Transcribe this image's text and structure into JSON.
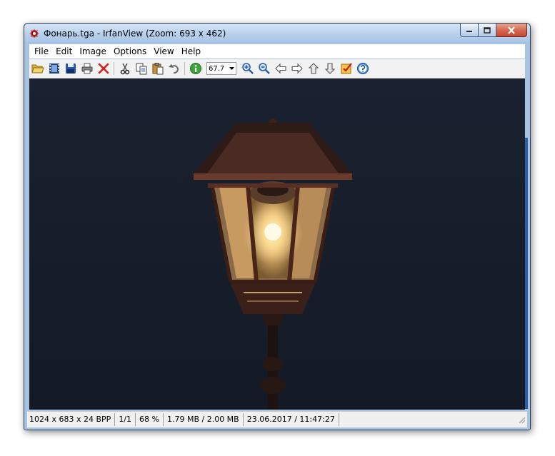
{
  "window": {
    "title": "Фонарь.tga - IrfanView (Zoom: 693 x 462)"
  },
  "menu": {
    "items": [
      "File",
      "Edit",
      "Image",
      "Options",
      "View",
      "Help"
    ]
  },
  "toolbar": {
    "buttons": [
      {
        "icon": "open-folder-icon"
      },
      {
        "icon": "filmstrip-icon"
      },
      {
        "icon": "save-icon"
      },
      {
        "icon": "print-icon"
      },
      {
        "icon": "delete-icon"
      },
      {
        "icon": "cut-icon"
      },
      {
        "icon": "copy-icon"
      },
      {
        "icon": "paste-icon"
      },
      {
        "icon": "undo-icon"
      },
      {
        "icon": "info-icon"
      },
      {
        "icon": "zoom-in-icon"
      },
      {
        "icon": "zoom-out-icon"
      },
      {
        "icon": "previous-arrow-icon"
      },
      {
        "icon": "next-arrow-icon"
      },
      {
        "icon": "first-file-icon"
      },
      {
        "icon": "last-file-icon"
      },
      {
        "icon": "settings-checkbox-icon"
      },
      {
        "icon": "help-icon"
      }
    ],
    "zoom_value": "67.7"
  },
  "status": {
    "dimensions": "1024 x 683 x 24 BPP",
    "page": "1/1",
    "zoom": "68 %",
    "size": "1.79 MB / 2.00 MB",
    "datetime": "23.06.2017 / 11:47:27"
  },
  "colors": {
    "image_background": "#171e2b",
    "lamp_glow": "#f2c27a",
    "scroll_accent": "#2e5ea9"
  }
}
